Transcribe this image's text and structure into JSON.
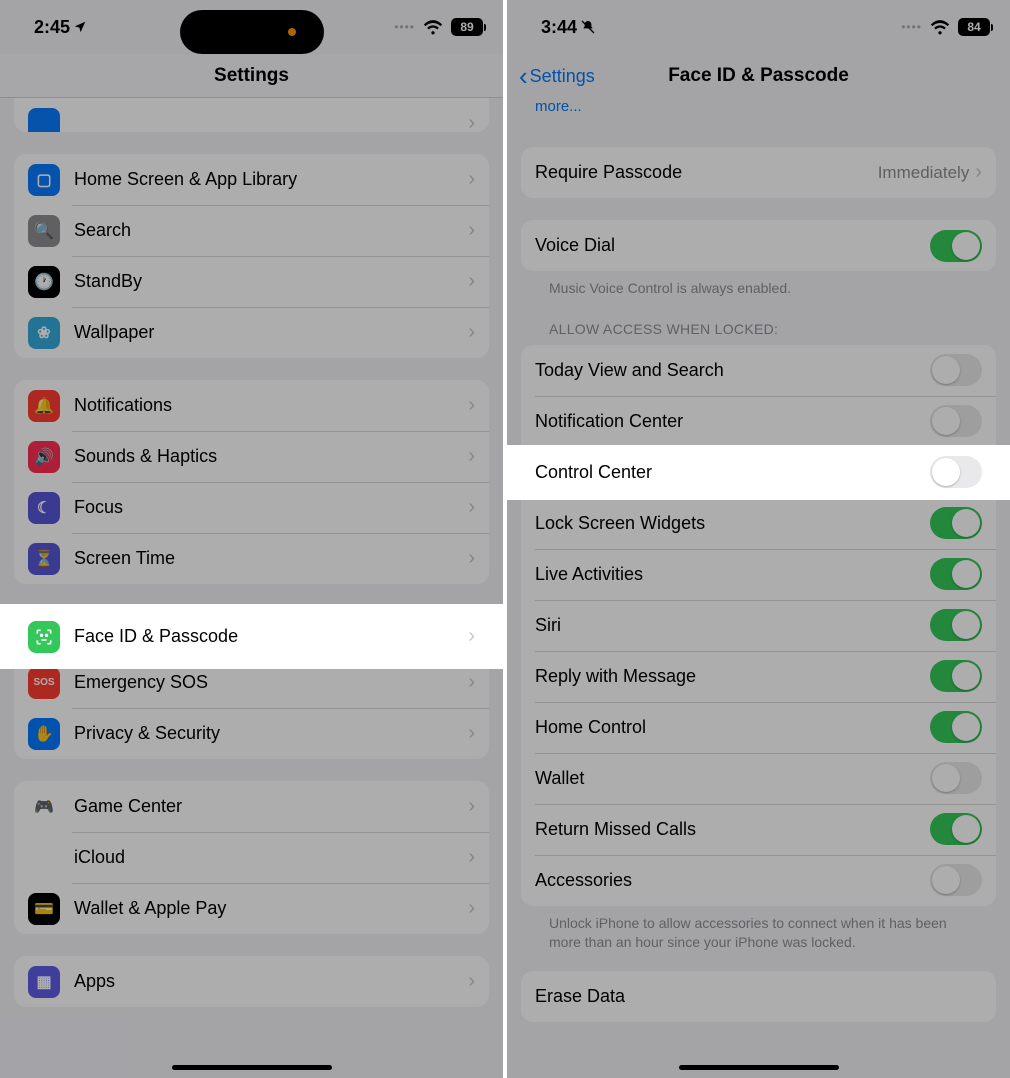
{
  "left": {
    "status": {
      "time": "2:45",
      "battery": "89"
    },
    "title": "Settings",
    "groups": [
      {
        "rows": [
          {
            "icon": "home-screen-icon",
            "bg": "#0a7bff",
            "glyph": "▢",
            "label": "Home Screen & App Library"
          },
          {
            "icon": "search-icon",
            "bg": "#8e8e93",
            "glyph": "🔍",
            "label": "Search"
          },
          {
            "icon": "standby-icon",
            "bg": "#000",
            "glyph": "🕐",
            "label": "StandBy"
          },
          {
            "icon": "wallpaper-icon",
            "bg": "#34aadc",
            "glyph": "❀",
            "label": "Wallpaper"
          }
        ]
      },
      {
        "rows": [
          {
            "icon": "notifications-icon",
            "bg": "#ff3b30",
            "glyph": "🔔",
            "label": "Notifications"
          },
          {
            "icon": "sounds-icon",
            "bg": "#ff2d55",
            "glyph": "🔊",
            "label": "Sounds & Haptics"
          },
          {
            "icon": "focus-icon",
            "bg": "#5856d6",
            "glyph": "☾",
            "label": "Focus"
          },
          {
            "icon": "screentime-icon",
            "bg": "#5856d6",
            "glyph": "⏳",
            "label": "Screen Time"
          }
        ]
      },
      {
        "rows": [
          {
            "icon": "faceid-icon",
            "bg": "#34c759",
            "glyph": "☺",
            "label": "Face ID & Passcode",
            "highlight": true
          },
          {
            "icon": "sos-icon",
            "bg": "#ff3b30",
            "glyph": "SOS",
            "label": "Emergency SOS"
          },
          {
            "icon": "privacy-icon",
            "bg": "#007aff",
            "glyph": "✋",
            "label": "Privacy & Security"
          }
        ]
      },
      {
        "rows": [
          {
            "icon": "gamecenter-icon",
            "bg": "#fff",
            "glyph": "🎮",
            "label": "Game Center"
          },
          {
            "icon": "icloud-icon",
            "bg": "#fff",
            "glyph": "☁︎",
            "label": "iCloud"
          },
          {
            "icon": "wallet-icon",
            "bg": "#000",
            "glyph": "💳",
            "label": "Wallet & Apple Pay"
          }
        ]
      },
      {
        "rows": [
          {
            "icon": "apps-icon",
            "bg": "#5e5ce6",
            "glyph": "▦",
            "label": "Apps"
          }
        ]
      }
    ]
  },
  "right": {
    "status": {
      "time": "3:44",
      "battery": "84"
    },
    "back": "Settings",
    "title": "Face ID & Passcode",
    "link_more": "more...",
    "require": {
      "label": "Require Passcode",
      "value": "Immediately"
    },
    "voice_dial": {
      "label": "Voice Dial",
      "on": true
    },
    "voice_caption": "Music Voice Control is always enabled.",
    "header_allow": "Allow Access When Locked:",
    "allow_rows": [
      {
        "label": "Today View and Search",
        "on": false
      },
      {
        "label": "Notification Center",
        "on": false
      },
      {
        "label": "Control Center",
        "on": false,
        "highlight": true
      },
      {
        "label": "Lock Screen Widgets",
        "on": true
      },
      {
        "label": "Live Activities",
        "on": true
      },
      {
        "label": "Siri",
        "on": true
      },
      {
        "label": "Reply with Message",
        "on": true
      },
      {
        "label": "Home Control",
        "on": true
      },
      {
        "label": "Wallet",
        "on": false
      },
      {
        "label": "Return Missed Calls",
        "on": true
      },
      {
        "label": "Accessories",
        "on": false
      }
    ],
    "accessories_caption": "Unlock iPhone to allow accessories to connect when it has been more than an hour since your iPhone was locked.",
    "erase": {
      "label": "Erase Data"
    }
  }
}
